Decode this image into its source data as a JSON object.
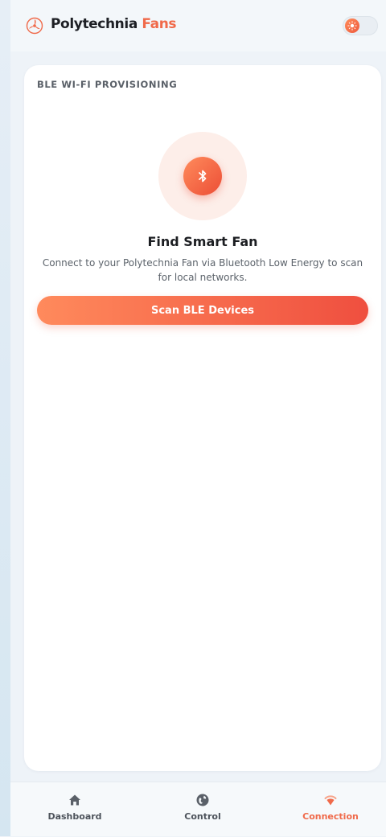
{
  "header": {
    "brand_primary": "Polytechnia",
    "brand_accent": "Fans",
    "logo_icon": "fan-logo-icon",
    "theme_toggle_icon": "sun-icon",
    "accent_color": "#f06a4a"
  },
  "card": {
    "section_label": "BLE WI-FI PROVISIONING",
    "icon": "bluetooth-icon",
    "title": "Find Smart Fan",
    "description": "Connect to your Polytechnia Fan via Bluetooth Low Energy to scan for local networks.",
    "scan_button_label": "Scan BLE Devices"
  },
  "bottom_nav": {
    "items": [
      {
        "label": "Dashboard",
        "icon": "home-icon",
        "active": false
      },
      {
        "label": "Control",
        "icon": "globe-icon",
        "active": false
      },
      {
        "label": "Connection",
        "icon": "wifi-icon",
        "active": true
      }
    ]
  }
}
